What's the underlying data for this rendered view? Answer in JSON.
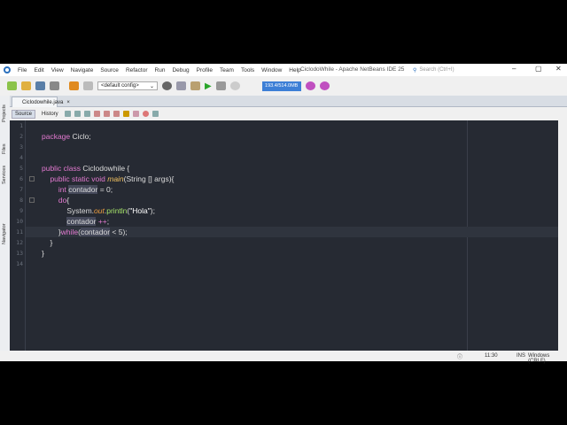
{
  "menubar": {
    "items": [
      "File",
      "Edit",
      "View",
      "Navigate",
      "Source",
      "Refactor",
      "Run",
      "Debug",
      "Profile",
      "Team",
      "Tools",
      "Window",
      "Help"
    ],
    "title": "CiclodoWhile - Apache NetBeans IDE 25",
    "search_placeholder": "Search (Ctrl+I)"
  },
  "toolbar": {
    "config": "<default config>",
    "memory": "193.4/514.0MB"
  },
  "tab": {
    "label": "Ciclodowhile.java"
  },
  "editor_tabs": {
    "source": "Source",
    "history": "History"
  },
  "sidebar": [
    "Projects",
    "Files",
    "Services",
    "Navigator"
  ],
  "code": {
    "lines": [
      "",
      "package Ciclo;",
      "",
      "",
      "public class Ciclodowhile {",
      "    public static void main(String [] args){",
      "        int contador = 0;",
      "        do{",
      "            System.out.println(\"Hola\");",
      "            contador ++;",
      "        }while(contador < 5);",
      "    }",
      "}",
      ""
    ]
  },
  "status": {
    "position": "11:30",
    "mode": "INS",
    "line_ending": "Windows (CRLF)"
  },
  "colors": {
    "keyword": "#e27ad0",
    "background": "#262a33",
    "accent": "#3d7fd6"
  }
}
